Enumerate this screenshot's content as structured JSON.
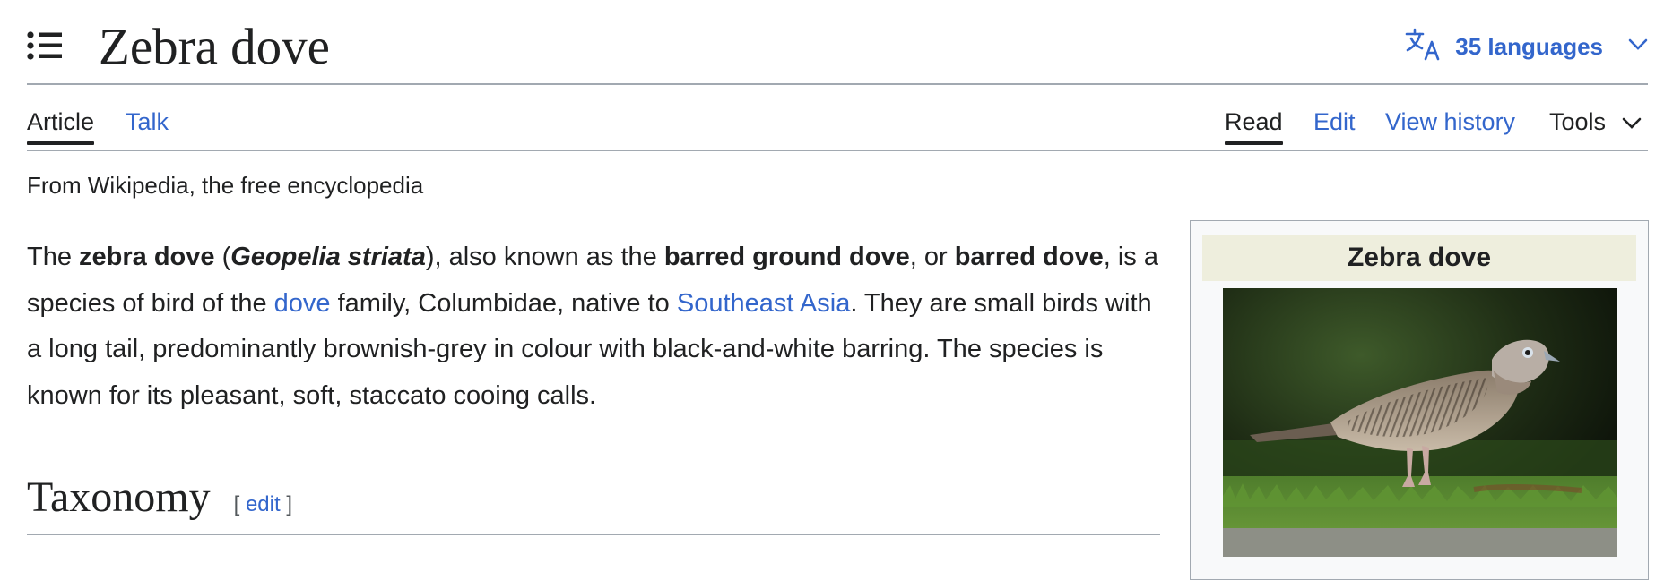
{
  "header": {
    "title": "Zebra dove",
    "languages_label": "35 languages",
    "icons": [
      "toc-list-icon",
      "translate-icon",
      "chevron-down-icon"
    ]
  },
  "tabs": {
    "left": [
      {
        "label": "Article",
        "selected": true
      },
      {
        "label": "Talk",
        "selected": false
      }
    ],
    "right": [
      {
        "label": "Read",
        "selected": true
      },
      {
        "label": "Edit",
        "selected": false
      },
      {
        "label": "View history",
        "selected": false
      },
      {
        "label": "Tools",
        "selected": false
      }
    ]
  },
  "tagline": "From Wikipedia, the free encyclopedia",
  "lead": {
    "t1": "The ",
    "b1": "zebra dove",
    "t2": " (",
    "bi1": "Geopelia striata",
    "t3": "), also known as the ",
    "b2": "barred ground dove",
    "t4": ", or ",
    "b3": "barred dove",
    "t5": ", is a species of bird of the ",
    "l1": "dove",
    "t6": " family, Columbidae, native to ",
    "l2": "Southeast Asia",
    "t7": ". They are small birds with a long tail, predominantly brownish-grey in colour with black-and-white barring. The species is known for its pleasant, soft, staccato cooing calls."
  },
  "section": {
    "heading": "Taxonomy",
    "edit_open": "[ ",
    "edit_label": "edit",
    "edit_close": " ]"
  },
  "infobox": {
    "title": "Zebra dove"
  },
  "colors": {
    "link": "#3366cc",
    "text": "#202122",
    "rule": "#a2a9b1",
    "infobox_title_bg": "#eeeedd"
  }
}
